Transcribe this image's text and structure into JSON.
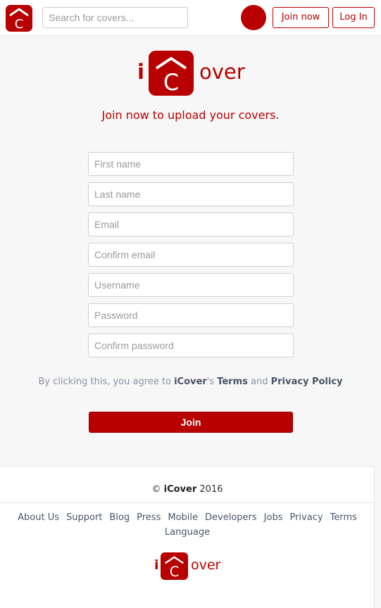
{
  "header": {
    "search_placeholder": "Search for covers...",
    "join_label": "Join now",
    "login_label": "Log In",
    "logo_letter": "C"
  },
  "brand": {
    "prefix": "i",
    "logo_letter": "C",
    "suffix": "over"
  },
  "signup": {
    "tagline": "Join now to upload your covers.",
    "fields": {
      "first_name": "First name",
      "last_name": "Last name",
      "email": "Email",
      "confirm_email": "Confirm email",
      "username": "Username",
      "password": "Password",
      "confirm_password": "Confirm password"
    },
    "agree_prefix": "By clicking this, you agree to ",
    "agree_brand": "iCover",
    "agree_possessive": "'s ",
    "agree_terms": "Terms",
    "agree_and": " and ",
    "agree_privacy": "Privacy Policy",
    "submit_label": "Join"
  },
  "footer": {
    "copyright_symbol": "©",
    "copyright_brand": "iCover",
    "copyright_year": "2016",
    "links": [
      "About Us",
      "Support",
      "Blog",
      "Press",
      "Mobile",
      "Developers",
      "Jobs",
      "Privacy",
      "Terms",
      "Language"
    ]
  },
  "colors": {
    "brand": "#b80000",
    "background": "#f7f7f7",
    "link": "#4a5566"
  },
  "icons": [
    "house-logo-icon",
    "avatar"
  ]
}
